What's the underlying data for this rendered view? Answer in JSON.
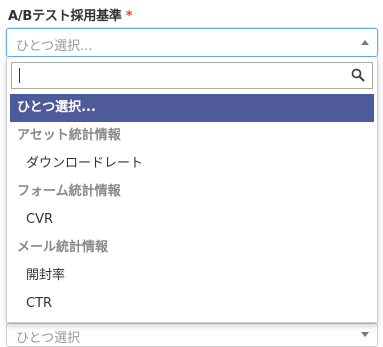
{
  "field": {
    "label": "A/Bテスト採用基準",
    "required_mark": "*"
  },
  "select": {
    "value": "ひとつ選択...",
    "caret_icon": "caret-up-icon"
  },
  "dropdown": {
    "search": {
      "value": "",
      "icon": "search-icon"
    },
    "options": [
      {
        "label": "ひとつ選択...",
        "kind": "highlighted"
      },
      {
        "label": "アセット統計情報",
        "kind": "group"
      },
      {
        "label": "ダウンロードレート",
        "kind": "child"
      },
      {
        "label": "フォーム統計情報",
        "kind": "group"
      },
      {
        "label": "CVR",
        "kind": "child"
      },
      {
        "label": "メール統計情報",
        "kind": "group"
      },
      {
        "label": "開封率",
        "kind": "child"
      },
      {
        "label": "CTR",
        "kind": "child"
      }
    ]
  },
  "next_select": {
    "value": "ひとつ選択"
  },
  "colors": {
    "highlight": "#4e5a9a",
    "required": "#e04a2a",
    "focus_border": "#66afe9"
  }
}
